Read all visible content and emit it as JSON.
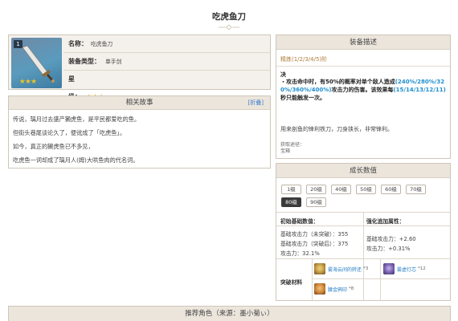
{
  "page": {
    "title": "吃虎鱼刀"
  },
  "weapon": {
    "rank_badge": "1",
    "thumb_stars": "★★★",
    "name_label": "名称：",
    "name_value": "吃虎鱼刀",
    "type_label": "装备类型：",
    "type_value": "单手剑",
    "stars_label": "星级：",
    "stars_value": "★★★"
  },
  "story": {
    "header": "相关故事",
    "fold": "[折叠]",
    "lines": [
      "传说，璃月过去盛产獭虎鱼，是平民都爱吃的鱼。",
      "但街头巷尾谈论久了，便讹成了「吃虎鱼」。",
      "如今，真正的獭虎鱼已不多见，",
      "吃虎鱼一词却成了璃月人(姆)大哄鱼肉的代名词。"
    ]
  },
  "description": {
    "header": "装备描述",
    "refine": "精炼(1/2/3/4/5)阶",
    "skill_name": "决",
    "effect_l1_a": "・攻击命中时，有50%的概率对单个敌人造成",
    "effect_l1_hl": "(240%/280%/32",
    "effect_l2_hl": "0%/360%/400%)",
    "effect_l2_b": "攻击力的伤害。该效果每",
    "effect_l2_hl2": "(15/14/13/12/11)",
    "effect_l3": "秒只能触发一次。",
    "flavor": "用来剖鱼的锋利铁刀，刀身挟长，非常锋利。",
    "source_label": "获取途径：",
    "source_value": "宝箱"
  },
  "growth": {
    "header": "成长数值",
    "levels": [
      "1级",
      "20级",
      "40级",
      "50级",
      "60级",
      "70级",
      "80级",
      "90级"
    ],
    "active_level": "80级",
    "col_base": "初始基础数值：",
    "col_refine": "强化追加属性：",
    "base_stats": [
      "基础攻击力（未突破）：355",
      "基础攻击力（突破后）：375",
      "攻击力：32.1%"
    ],
    "refine_stats": [
      "基础攻击力：+2.60",
      "攻击力：+0.31%"
    ],
    "materials_label": "突破材料",
    "materials": [
      {
        "name": "雾海云间的转还",
        "count": "*3",
        "color": "#c9a24a"
      },
      {
        "name": "雾虚灯芯",
        "count": "*12",
        "color": "#7a64b0"
      },
      {
        "name": "腰金鸦印",
        "count": "*8",
        "color": "#d08a3a"
      }
    ]
  },
  "recommend": {
    "header": "推荐角色（来源：墨小菊ぃ）"
  }
}
